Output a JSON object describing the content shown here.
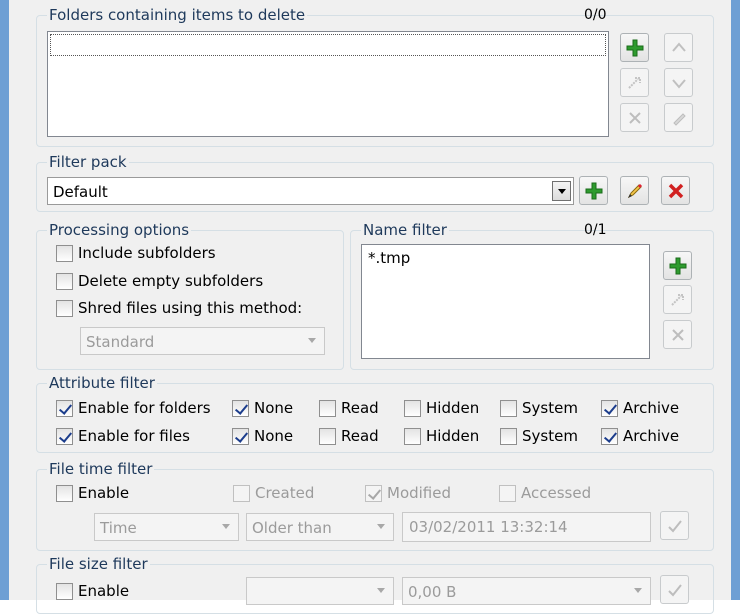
{
  "folders_group": {
    "title": "Folders containing items to delete",
    "count": "0/0"
  },
  "filter_pack": {
    "title": "Filter pack",
    "selected": "Default"
  },
  "processing_options": {
    "title": "Processing options",
    "include_subfolders": "Include subfolders",
    "delete_empty_subfolders": "Delete empty subfolders",
    "shred_files": "Shred files using this method:",
    "shred_method": "Standard"
  },
  "name_filter": {
    "title": "Name filter",
    "count": "0/1",
    "items": [
      "*.tmp"
    ]
  },
  "attribute_filter": {
    "title": "Attribute filter",
    "folders": {
      "enable": "Enable for folders",
      "none": "None",
      "read": "Read",
      "hidden": "Hidden",
      "system": "System",
      "archive": "Archive"
    },
    "files": {
      "enable": "Enable for files",
      "none": "None",
      "read": "Read",
      "hidden": "Hidden",
      "system": "System",
      "archive": "Archive"
    }
  },
  "file_time_filter": {
    "title": "File time filter",
    "enable": "Enable",
    "created": "Created",
    "modified": "Modified",
    "accessed": "Accessed",
    "time_type": "Time",
    "comparison": "Older than",
    "datetime": "03/02/2011 13:32:14"
  },
  "file_size_filter": {
    "title": "File size filter",
    "enable": "Enable",
    "comparison": "",
    "size": "0,00 B"
  },
  "colors": {
    "window_border": "#6e9fd4",
    "group_title": "#1e395b",
    "add_icon": "#2e9b2e",
    "delete_icon": "#d12020"
  },
  "icons": [
    "plus-icon",
    "arrow-up-icon",
    "arrow-down-icon",
    "move-icon",
    "remove-icon",
    "edit-icon",
    "pencil-icon",
    "delete-icon",
    "apply-icon"
  ]
}
